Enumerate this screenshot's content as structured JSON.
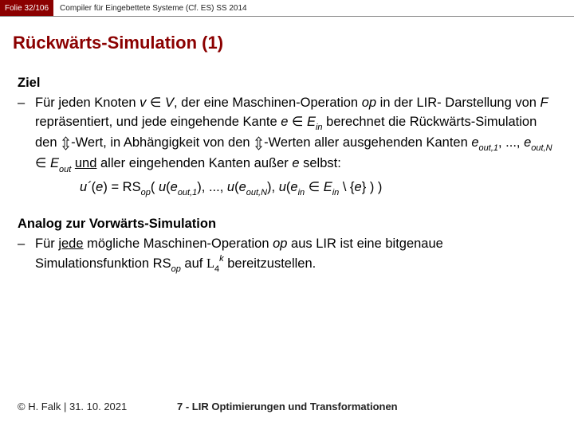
{
  "header": {
    "slide_number": "Folie 32/106",
    "course": "Compiler für Eingebettete Systeme (Cf. ES) SS 2014"
  },
  "title": "Rückwärts-Simulation (1)",
  "section1": {
    "label": "Ziel",
    "dash": "–",
    "line1_a": "Für jeden Knoten ",
    "line1_v": "v",
    "line1_in": " ∈ ",
    "line1_V": "V",
    "line1_b": ", der eine Maschinen-Operation ",
    "line1_op": "op",
    "line1_c": " in der LIR-",
    "line2_a": "Darstellung von ",
    "line2_F": "F",
    "line2_b": " repräsentiert, und jede eingehende Kante ",
    "line2_e": "e",
    "line2_in": " ∈ ",
    "line2_Ein": "E",
    "line2_Ein_sub": "in",
    "line3_a": "berechnet die Rückwärts-Simulation den ",
    "line3_b": "-Wert, in Abhängigkeit von den",
    "line4_a": "-Werten aller ausgehenden Kanten ",
    "line4_eout": "e",
    "line4_eout_sub1": "out,1",
    "line4_sep": ", ..., ",
    "line4_eoutN": "e",
    "line4_eout_subN": "out,N",
    "line4_in": " ∈ ",
    "line4_Eout": "E",
    "line4_Eout_sub": "out",
    "line4_space": " ",
    "line4_und": "und",
    "line4_b": " aller",
    "line5_a": "eingehenden Kanten außer ",
    "line5_e": "e",
    "line5_b": " selbst:",
    "formula": {
      "uprime": "u´",
      "open": "(",
      "e": "e",
      "eq": ") = RS",
      "op_sub": "op",
      "p1": "( ",
      "u": "u",
      "lp": "(",
      "eo1": "e",
      "eo1_sub": "out,1",
      "rp": ")",
      "dots": ", ..., ",
      "eoN": "e",
      "eoN_sub": "out,N",
      "c2": ", ",
      "ein": "e",
      "ein_sub": "in",
      "inrel": " ∈ ",
      "Ein": "E",
      "Ein_sub": "in",
      "setminus": " \\ {",
      "eset": "e",
      "close": "} ) )"
    }
  },
  "section2": {
    "label": "Analog zur Vorwärts-Simulation",
    "dash": "–",
    "line1_a": "Für ",
    "line1_jede": "jede",
    "line1_b": " mögliche Maschinen-Operation ",
    "line1_op": "op",
    "line1_c": " aus LIR ist eine bitgenaue",
    "line2_a": "Simulationsfunktion RS",
    "line2_op_sub": "op",
    "line2_b": " auf ",
    "line2_L": "L",
    "line2_4": "4",
    "line2_k": "k",
    "line2_c": " bereitzustellen."
  },
  "footer": {
    "left": "© H. Falk | 31. 10. 2021",
    "center": "7 - LIR Optimierungen und Transformationen"
  }
}
